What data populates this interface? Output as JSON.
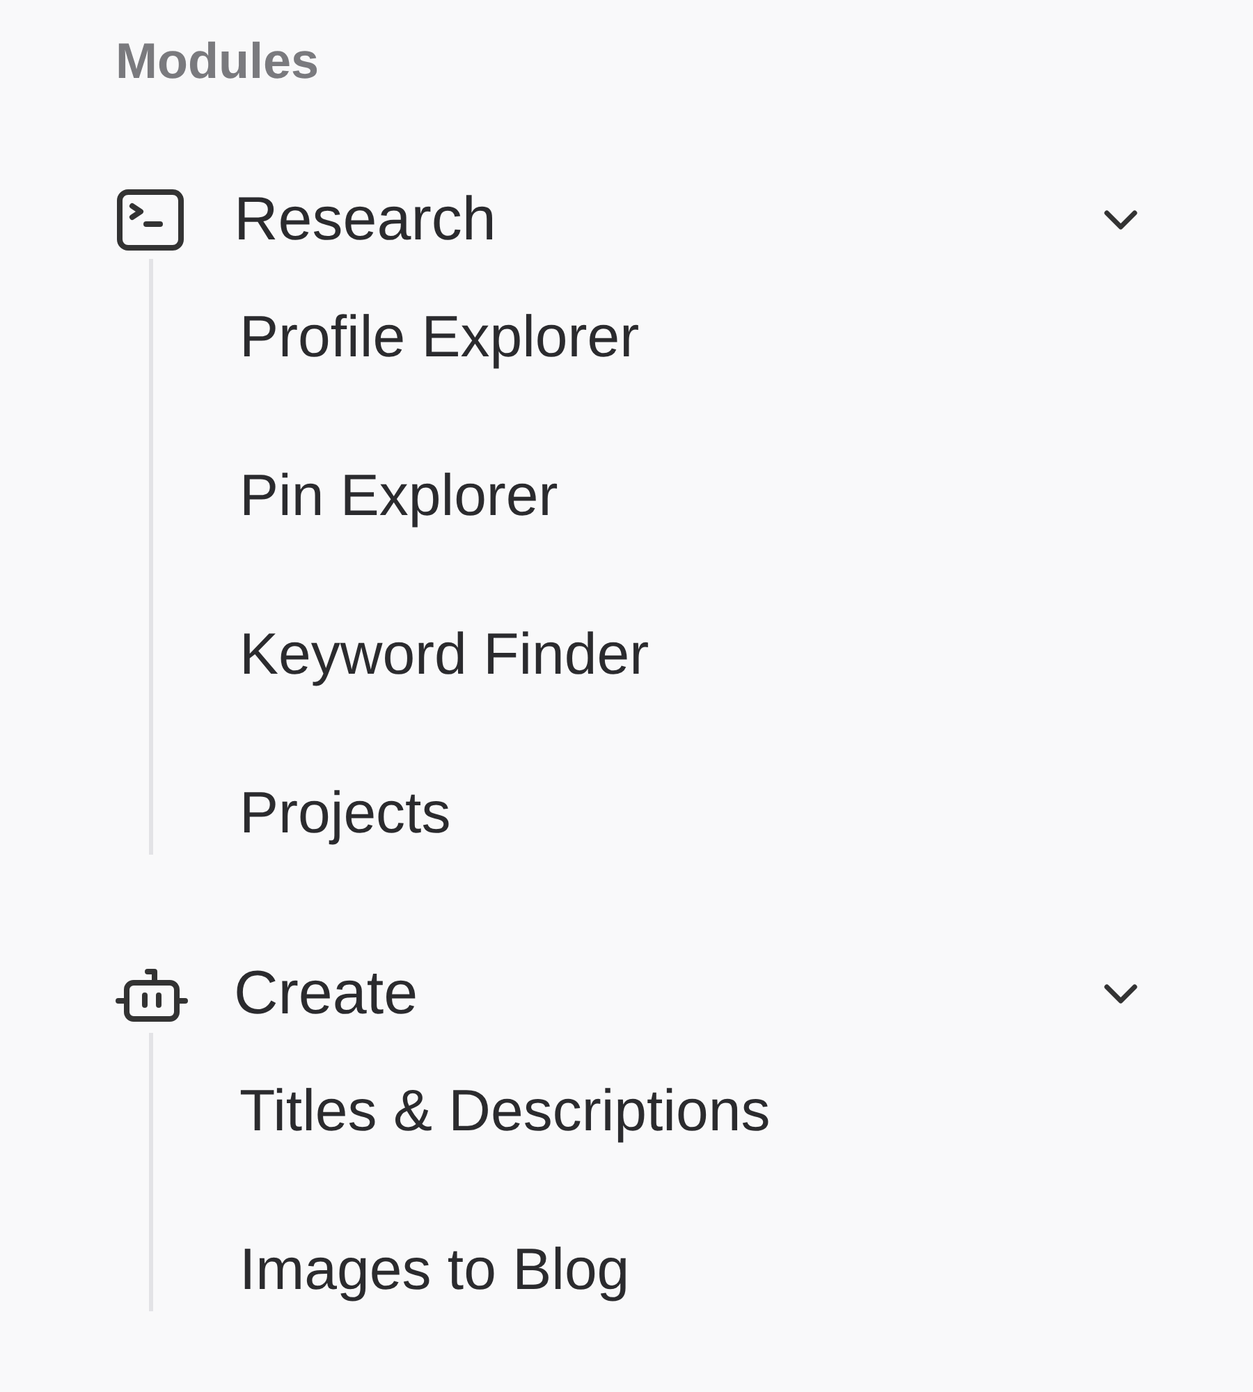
{
  "sidebar": {
    "section_title": "Modules",
    "groups": [
      {
        "label": "Research",
        "kind": "terminal",
        "expanded": true,
        "children": [
          {
            "label": "Profile Explorer"
          },
          {
            "label": "Pin Explorer"
          },
          {
            "label": "Keyword Finder"
          },
          {
            "label": "Projects"
          }
        ]
      },
      {
        "label": "Create",
        "kind": "robot",
        "expanded": true,
        "children": [
          {
            "label": "Titles & Descriptions"
          },
          {
            "label": "Images to Blog"
          }
        ]
      }
    ]
  }
}
